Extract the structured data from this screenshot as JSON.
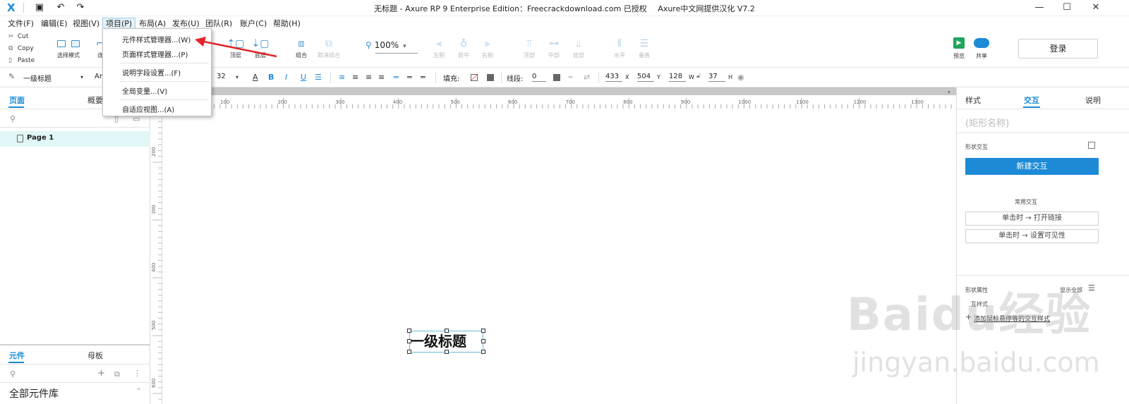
{
  "titlebar": {
    "title_main": "无标题 - Axure RP 9 Enterprise Edition：Freecrackdownload.com 已授权",
    "title_extra": "Axure中文网提供汉化 V7.2"
  },
  "menubar": {
    "items": [
      "文件(F)",
      "编辑(E)",
      "视图(V)",
      "项目(P)",
      "布局(A)",
      "发布(U)",
      "团队(R)",
      "账户(C)",
      "帮助(H)"
    ]
  },
  "dropdown": {
    "items": [
      "元件样式管理器...(W)",
      "页面样式管理器...(P)",
      "说明字段设置...(F)",
      "全局变量...(V)",
      "自适应视图...(A)"
    ]
  },
  "toolbar": {
    "cut": "Cut",
    "copy": "Copy",
    "paste": "Paste",
    "select_mode": "选择模式",
    "partial_left": "连",
    "top_layer": "顶层",
    "bottom_layer": "底层",
    "group": "组合",
    "ungroup": "取消组合",
    "zoom": "100%",
    "align_left": "左侧",
    "align_center": "居中",
    "align_right": "右侧",
    "align_top": "顶部",
    "align_middle": "中部",
    "align_bottom": "底部",
    "dist_horizontal": "水平",
    "dist_vertical": "垂直",
    "preview": "预览",
    "share": "共享",
    "login": "登录"
  },
  "stylebar": {
    "style_name": "一级标题",
    "font_partial": "Ar",
    "font_size": "32",
    "fill_label": "填充:",
    "line_label": "线段:",
    "line_width": "0",
    "x": "433",
    "x_label": "X",
    "y": "504",
    "y_label": "Y",
    "w": "128",
    "w_label": "W",
    "h": "37",
    "h_label": "H"
  },
  "leftpanel": {
    "tab_pages": "页面",
    "tab_outline": "概要",
    "page_item": "Page 1",
    "tab_widgets": "元件",
    "tab_masters": "母板",
    "library": "全部元件库"
  },
  "canvas": {
    "hruler_labels": [
      "100",
      "200",
      "300",
      "400",
      "500",
      "600",
      "700",
      "800",
      "900",
      "1000",
      "1100",
      "1200",
      "1300"
    ],
    "vruler_labels": [
      "200",
      "300",
      "400",
      "500",
      "600"
    ],
    "widget_text": "一级标题"
  },
  "rightpanel": {
    "tab_style": "样式",
    "tab_interaction": "交互",
    "tab_notes": "说明",
    "shape_name_placeholder": "(矩形名称)",
    "shape_interaction": "形状交互",
    "new_interaction": "新建交互",
    "common_interaction": "常用交互",
    "click_open_link": "单击时 → 打开链接",
    "click_set_visible": "单击时 → 设置可见性",
    "shape_properties": "形状属性",
    "show_all": "显示全部",
    "interaction_style": "互样式",
    "add_interaction_style": "添加鼠标悬停等的交互样式"
  },
  "watermark": {
    "line1": "Baidu经验",
    "line2": "jingyan.baidu.com"
  },
  "colors": {
    "accent": "#1c8ad6",
    "arrow": "#e0262a",
    "page_selected": "#e1f6f6",
    "preview_green": "#1fa45f"
  }
}
